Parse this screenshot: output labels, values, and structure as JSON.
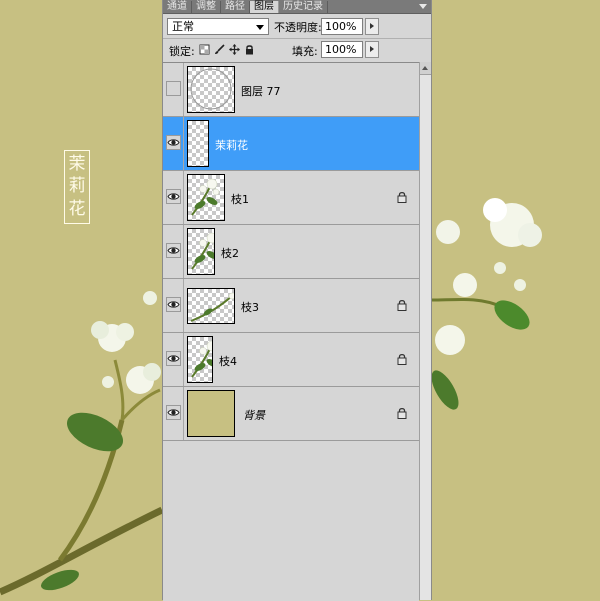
{
  "artwork": {
    "title_chars": [
      "茉",
      "莉",
      "花"
    ],
    "background_color": "#c7c082"
  },
  "panel": {
    "tabs": [
      {
        "label": "通道",
        "active": false
      },
      {
        "label": "调整",
        "active": false
      },
      {
        "label": "路径",
        "active": false
      },
      {
        "label": "图层",
        "active": true
      },
      {
        "label": "历史记录",
        "active": false
      }
    ],
    "blend_mode": "正常",
    "opacity_label": "不透明度:",
    "opacity_value": "100%",
    "lock_label": "锁定:",
    "fill_label": "填充:",
    "fill_value": "100%",
    "lock_icons": [
      "lock-transparent-icon",
      "lock-paint-icon",
      "lock-move-icon",
      "lock-all-icon"
    ],
    "selected_color": "#3f9df8"
  },
  "layers": [
    {
      "name": "图层 77",
      "visible": false,
      "selected": false,
      "locked": false,
      "thumb": "circle"
    },
    {
      "name": "茉莉花",
      "visible": true,
      "selected": true,
      "locked": false,
      "thumb": "empty"
    },
    {
      "name": "枝1",
      "visible": true,
      "selected": false,
      "locked": true,
      "thumb": "flower"
    },
    {
      "name": "枝2",
      "visible": true,
      "selected": false,
      "locked": false,
      "thumb": "flower"
    },
    {
      "name": "枝3",
      "visible": true,
      "selected": false,
      "locked": true,
      "thumb": "branch"
    },
    {
      "name": "枝4",
      "visible": true,
      "selected": false,
      "locked": true,
      "thumb": "flower"
    },
    {
      "name": "背景",
      "visible": true,
      "selected": false,
      "locked": true,
      "thumb": "solid"
    }
  ]
}
